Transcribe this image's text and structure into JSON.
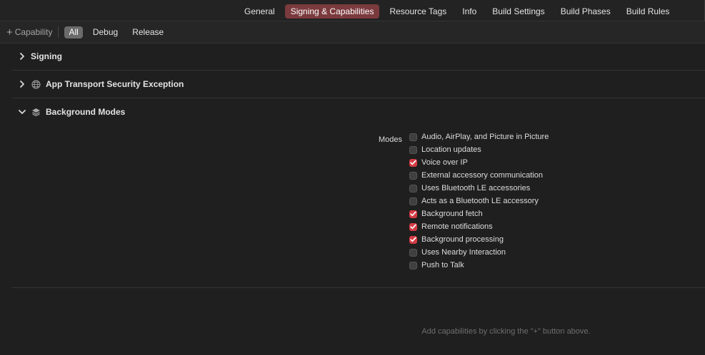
{
  "tabs": [
    {
      "label": "General",
      "active": false
    },
    {
      "label": "Signing & Capabilities",
      "active": true
    },
    {
      "label": "Resource Tags",
      "active": false
    },
    {
      "label": "Info",
      "active": false
    },
    {
      "label": "Build Settings",
      "active": false
    },
    {
      "label": "Build Phases",
      "active": false
    },
    {
      "label": "Build Rules",
      "active": false
    }
  ],
  "toolbar": {
    "add_capability_label": "Capability",
    "add_capability_icon": "plus-icon",
    "filters": [
      {
        "label": "All",
        "active": true
      },
      {
        "label": "Debug",
        "active": false
      },
      {
        "label": "Release",
        "active": false
      }
    ]
  },
  "sections": {
    "signing": {
      "title": "Signing",
      "expanded": false
    },
    "ats": {
      "title": "App Transport Security Exception",
      "expanded": false,
      "icon": "globe-icon"
    },
    "background_modes": {
      "title": "Background Modes",
      "expanded": true,
      "icon": "layers-icon"
    }
  },
  "modes": {
    "label": "Modes",
    "items": [
      {
        "label": "Audio, AirPlay, and Picture in Picture",
        "checked": false
      },
      {
        "label": "Location updates",
        "checked": false
      },
      {
        "label": "Voice over IP",
        "checked": true
      },
      {
        "label": "External accessory communication",
        "checked": false
      },
      {
        "label": "Uses Bluetooth LE accessories",
        "checked": false
      },
      {
        "label": "Acts as a Bluetooth LE accessory",
        "checked": false
      },
      {
        "label": "Background fetch",
        "checked": true
      },
      {
        "label": "Remote notifications",
        "checked": true
      },
      {
        "label": "Background processing",
        "checked": true
      },
      {
        "label": "Uses Nearby Interaction",
        "checked": false
      },
      {
        "label": "Push to Talk",
        "checked": false
      }
    ]
  },
  "hint": "Add capabilities by clicking the \"+\" button above.",
  "colors": {
    "accent_tab": "#7b3a3d",
    "checkbox_checked": "#d53b44",
    "background": "#1f1f1f"
  }
}
